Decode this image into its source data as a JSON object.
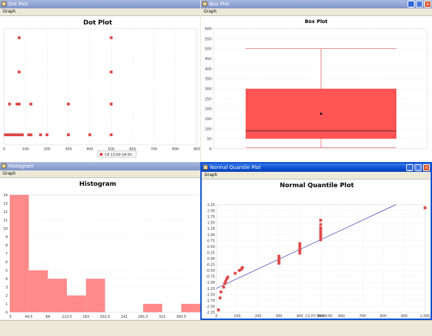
{
  "dot": {
    "title": "Dot Plot",
    "window_title": "Dot Plot",
    "menu": "Graph",
    "legend": "C8 13:00-14:00",
    "xticks": [
      "0",
      "100",
      "200",
      "300",
      "400",
      "500",
      "600",
      "700",
      "800",
      "900"
    ],
    "xrange": [
      0,
      900
    ],
    "points": [
      {
        "x": 70,
        "y": 4
      },
      {
        "x": 500,
        "y": 4
      },
      {
        "x": 70,
        "y": 3
      },
      {
        "x": 500,
        "y": 3
      },
      {
        "x": 25,
        "y": 2
      },
      {
        "x": 60,
        "y": 2
      },
      {
        "x": 70,
        "y": 2
      },
      {
        "x": 125,
        "y": 2
      },
      {
        "x": 300,
        "y": 2
      },
      {
        "x": 500,
        "y": 2
      },
      {
        "x": 5,
        "y": 1
      },
      {
        "x": 15,
        "y": 1
      },
      {
        "x": 25,
        "y": 1
      },
      {
        "x": 35,
        "y": 1
      },
      {
        "x": 45,
        "y": 1
      },
      {
        "x": 55,
        "y": 1
      },
      {
        "x": 65,
        "y": 1
      },
      {
        "x": 75,
        "y": 1
      },
      {
        "x": 85,
        "y": 1
      },
      {
        "x": 115,
        "y": 1
      },
      {
        "x": 125,
        "y": 1
      },
      {
        "x": 170,
        "y": 1
      },
      {
        "x": 200,
        "y": 1
      },
      {
        "x": 300,
        "y": 1
      },
      {
        "x": 400,
        "y": 1
      },
      {
        "x": 500,
        "y": 1
      }
    ]
  },
  "box": {
    "title": "Box Plot",
    "window_title": "Box Plot",
    "menu": "Graph",
    "yticks": [
      "0",
      "50",
      "100",
      "150",
      "200",
      "250",
      "300",
      "350",
      "400",
      "450",
      "500",
      "550",
      "600"
    ],
    "yrange": [
      0,
      600
    ],
    "whisker_low": 5,
    "q1": 50,
    "median": 90,
    "q3": 300,
    "whisker_high": 500,
    "mean": 175
  },
  "hist": {
    "title": "Histogram",
    "window_title": "Histogram",
    "menu": "Graph",
    "xticks": [
      "5",
      "44.5",
      "84",
      "123.5",
      "163",
      "202.5",
      "242",
      "281.5",
      "321",
      "360.5"
    ],
    "yticks": [
      "0",
      "1",
      "2",
      "3",
      "4",
      "5",
      "6",
      "7",
      "8",
      "9",
      "10",
      "11",
      "12",
      "13",
      "14"
    ],
    "yrange": [
      0,
      14
    ],
    "bins": [
      {
        "start": 5,
        "end": 44.5,
        "count": 14
      },
      {
        "start": 44.5,
        "end": 84,
        "count": 5
      },
      {
        "start": 84,
        "end": 123.5,
        "count": 4
      },
      {
        "start": 123.5,
        "end": 163,
        "count": 2
      },
      {
        "start": 163,
        "end": 202.5,
        "count": 4
      },
      {
        "start": 202.5,
        "end": 242,
        "count": 0
      },
      {
        "start": 242,
        "end": 281.5,
        "count": 0
      },
      {
        "start": 281.5,
        "end": 321,
        "count": 1
      },
      {
        "start": 321,
        "end": 360.5,
        "count": 0
      },
      {
        "start": 360.5,
        "end": 400,
        "count": 1
      }
    ]
  },
  "nq": {
    "title": "Normal Quantile Plot",
    "window_title": "Normal Quantile Plot",
    "menu": "Graph",
    "xlabel": "C2 07:00-08:00",
    "xticks": [
      "0",
      "100",
      "200",
      "300",
      "400",
      "500",
      "600",
      "700",
      "800",
      "900",
      "1,000"
    ],
    "yticks": [
      "-2.25",
      "-2.00",
      "-1.75",
      "-1.50",
      "-1.25",
      "-1.00",
      "-0.75",
      "-0.50",
      "-0.25",
      "0.00",
      "0.25",
      "0.50",
      "0.75",
      "1.00",
      "1.25",
      "1.50",
      "1.75",
      "2.00",
      "2.25"
    ],
    "xrange": [
      0,
      1000
    ],
    "yrange": [
      -2.25,
      2.25
    ],
    "line": [
      [
        0,
        -1.25
      ],
      [
        860,
        2.25
      ]
    ],
    "points": [
      {
        "x": 10,
        "y": -2.15
      },
      {
        "x": 18,
        "y": -1.65
      },
      {
        "x": 22,
        "y": -1.4
      },
      {
        "x": 35,
        "y": -1.2
      },
      {
        "x": 40,
        "y": -1.05
      },
      {
        "x": 45,
        "y": -0.95
      },
      {
        "x": 50,
        "y": -0.85
      },
      {
        "x": 55,
        "y": -0.78
      },
      {
        "x": 90,
        "y": -0.62
      },
      {
        "x": 110,
        "y": -0.5
      },
      {
        "x": 120,
        "y": -0.45
      },
      {
        "x": 125,
        "y": -0.38
      },
      {
        "x": 300,
        "y": -0.2
      },
      {
        "x": 300,
        "y": -0.12
      },
      {
        "x": 300,
        "y": -0.05
      },
      {
        "x": 300,
        "y": 0.02
      },
      {
        "x": 300,
        "y": 0.1
      },
      {
        "x": 400,
        "y": 0.22
      },
      {
        "x": 400,
        "y": 0.3
      },
      {
        "x": 400,
        "y": 0.38
      },
      {
        "x": 400,
        "y": 0.45
      },
      {
        "x": 400,
        "y": 0.55
      },
      {
        "x": 400,
        "y": 0.62
      },
      {
        "x": 500,
        "y": 0.78
      },
      {
        "x": 500,
        "y": 0.88
      },
      {
        "x": 500,
        "y": 0.98
      },
      {
        "x": 500,
        "y": 1.08
      },
      {
        "x": 500,
        "y": 1.18
      },
      {
        "x": 500,
        "y": 1.28
      },
      {
        "x": 500,
        "y": 1.42
      },
      {
        "x": 500,
        "y": 1.6
      },
      {
        "x": 1000,
        "y": 2.12
      }
    ]
  },
  "colors": {
    "point": "#e04848",
    "box_fill": "#ff5555",
    "hist_fill": "#ff8a8a",
    "line": "#3030b0"
  }
}
